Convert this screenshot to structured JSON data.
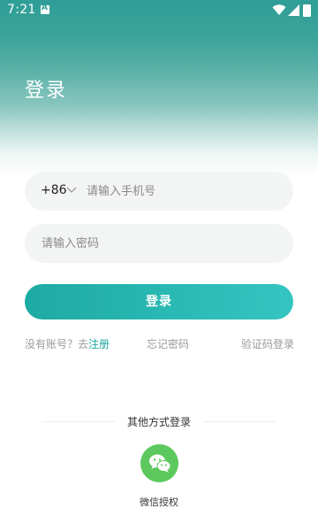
{
  "status_bar": {
    "time": "7:21"
  },
  "page": {
    "title": "登录"
  },
  "phone": {
    "country_code": "+86",
    "placeholder": "请输入手机号",
    "value": ""
  },
  "password": {
    "placeholder": "请输入密码",
    "value": ""
  },
  "login_button": {
    "label": "登录"
  },
  "links": {
    "no_account_text": "没有账号？去",
    "register_label": "注册",
    "forgot_password_label": "忘记密码",
    "sms_login_label": "验证码登录"
  },
  "other_login": {
    "title": "其他方式登录",
    "wechat_label": "微信授权"
  },
  "colors": {
    "accent": "#1aa6a0",
    "header_teal": "#2f9e96",
    "wechat_green": "#5cc85d"
  },
  "icons": {
    "status": [
      "notification-a-icon",
      "wifi-icon",
      "signal-icon",
      "battery-icon"
    ],
    "country_selector": "chevron-down-icon",
    "social": "wechat-icon"
  }
}
